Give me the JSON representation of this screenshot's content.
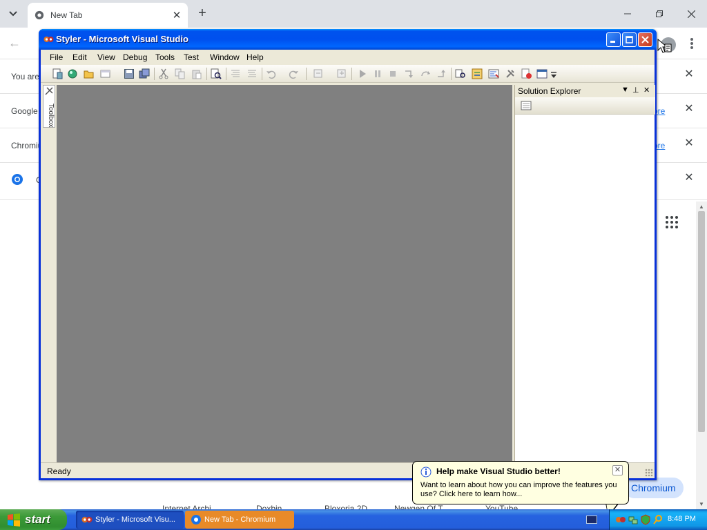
{
  "chrome": {
    "tab_title": "New Tab",
    "info_bars": [
      {
        "text": "You are",
        "link": ""
      },
      {
        "text": "Google",
        "link": "ore"
      },
      {
        "text": "Chromiu",
        "link": "ore"
      },
      {
        "text": "C",
        "link": ""
      }
    ],
    "shortcuts": [
      "Internet Archi...",
      "Doxbin",
      "Bloxoria 2D",
      "Newgen Of T...",
      "YouTube"
    ],
    "customize_label": "Chromium"
  },
  "vs": {
    "title": "Styler - Microsoft Visual Studio",
    "menu": [
      "File",
      "Edit",
      "View",
      "Debug",
      "Tools",
      "Test",
      "Window",
      "Help"
    ],
    "toolbox_label": "Toolbox",
    "solution_explorer_title": "Solution Explorer",
    "status": "Ready",
    "icons": {
      "toolbar": [
        "new-project-icon",
        "add-item-icon",
        "open-file-icon",
        "add-new-item-icon",
        "save-icon",
        "save-all-icon",
        "cut-icon",
        "copy-icon",
        "paste-icon",
        "find-icon",
        "comment-icon",
        "uncomment-icon",
        "undo-icon",
        "redo-icon",
        "navigate-back-icon",
        "navigate-forward-icon",
        "start-debug-icon",
        "pause-icon",
        "stop-icon",
        "step-into-icon",
        "step-over-icon",
        "step-out-icon",
        "find-in-files-icon",
        "solution-explorer-icon",
        "properties-icon",
        "toolbox-icon",
        "object-browser-icon",
        "command-window-icon",
        "toolbar-options-icon"
      ]
    }
  },
  "balloon": {
    "title": "Help make Visual Studio better!",
    "body": "Want to learn about how you can improve the features you use? Click here to learn how..."
  },
  "taskbar": {
    "start_label": "start",
    "tasks": [
      "Styler - Microsoft Visu...",
      "New Tab - Chromium"
    ],
    "clock": "8:48 PM"
  },
  "colors": {
    "xp_blue": "#0054e3",
    "chrome_task": "#e88a28",
    "balloon_bg": "#ffffe1",
    "doc_gray": "#808080"
  }
}
